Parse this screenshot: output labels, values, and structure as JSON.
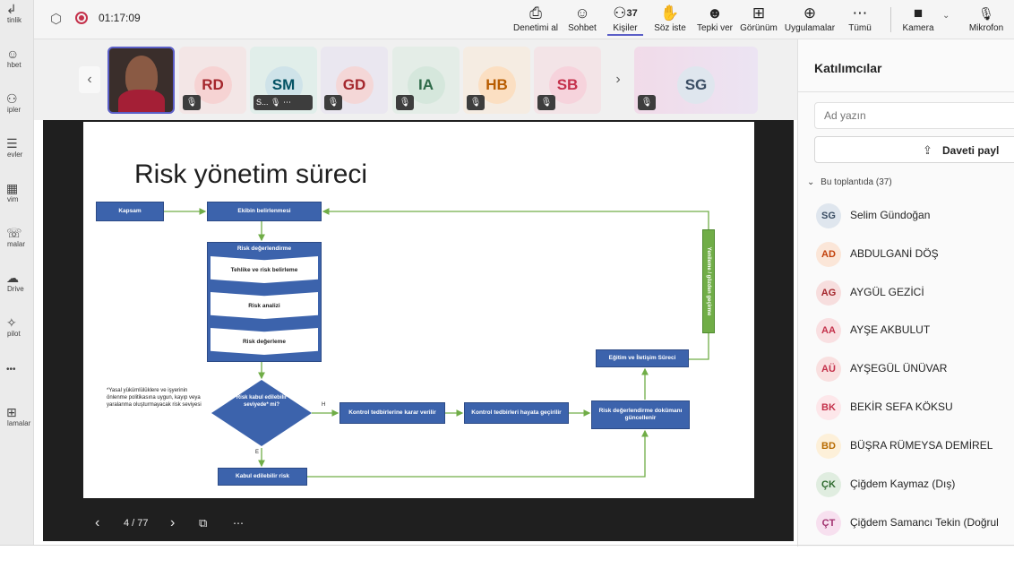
{
  "rail": {
    "items": [
      {
        "icon": "↲",
        "label": "tinlik"
      },
      {
        "icon": "☺",
        "label": "hbet"
      },
      {
        "icon": "⚇",
        "label": "ipler"
      },
      {
        "icon": "☰",
        "label": "evler"
      },
      {
        "icon": "▦",
        "label": "vim"
      },
      {
        "icon": "☏",
        "label": "malar"
      },
      {
        "icon": "☁",
        "label": "Drive"
      },
      {
        "icon": "✧",
        "label": "pilot"
      },
      {
        "icon": "•••",
        "label": ""
      },
      {
        "icon": "⊞",
        "label": "lamalar"
      }
    ]
  },
  "topbar": {
    "timer": "01:17:09",
    "participant_count": "37",
    "buttons": [
      {
        "icon": "⎙",
        "label": "Denetimi al"
      },
      {
        "icon": "☺",
        "label": "Sohbet"
      },
      {
        "icon": "⚇",
        "label": "Kişiler"
      },
      {
        "icon": "✋",
        "label": "Söz iste"
      },
      {
        "icon": "☻",
        "label": "Tepki ver"
      },
      {
        "icon": "⊞",
        "label": "Görünüm"
      },
      {
        "icon": "⊕",
        "label": "Uygulamalar"
      },
      {
        "icon": "⋯",
        "label": "Tümü"
      },
      {
        "icon": "■",
        "label": "Kamera"
      },
      {
        "icon": "🎙",
        "label": "Mikrofon"
      }
    ]
  },
  "strip": {
    "tiles": [
      {
        "initials": "RD",
        "name": ""
      },
      {
        "initials": "SM",
        "name": "S..."
      },
      {
        "initials": "GD",
        "name": ""
      },
      {
        "initials": "IA",
        "name": ""
      },
      {
        "initials": "HB",
        "name": ""
      },
      {
        "initials": "SB",
        "name": ""
      }
    ],
    "pinned": {
      "initials": "SG"
    }
  },
  "slide": {
    "title": "Risk yönetim süreci",
    "boxes": {
      "kapsam": "Kapsam",
      "ekip": "Ekibin belirlenmesi",
      "risk_deg_header": "Risk değerlendirme",
      "tehlike": "Tehlike ve risk belirleme",
      "analiz": "Risk analizi",
      "degerleme": "Risk değerleme",
      "kabul_q": "Risk kabul edilebilir seviyede* mi?",
      "kontrol_karar": "Kontrol tedbirlerine karar verilir",
      "kontrol_hayata": "Kontrol tedbirleri hayata geçirilir",
      "dokuman": "Risk değerlendirme dokümanı güncellenir",
      "egitim": "Eğitim ve İletişim Süreci",
      "kabul_risk": "Kabul edilebilir risk",
      "yenileme": "Yenileme / gözden geçirme"
    },
    "labels": {
      "h": "H",
      "e": "E"
    },
    "footnote": "*Yasal yükümlülüklere ve işyerinin önlenme politikasına uygun, kayıp veya yaralanma oluşturmayacak risk seviyesi"
  },
  "slide_controls": {
    "page": "4 / 77"
  },
  "panel": {
    "title": "Katılımcılar",
    "search_placeholder": "Ad yazın",
    "share_label": "Daveti payl",
    "section_label": "Bu toplantıda (37)",
    "people": [
      {
        "initials": "SG",
        "name": "Selim Gündoğan",
        "bg": "#dfe6ee",
        "fg": "#3b4e64"
      },
      {
        "initials": "AD",
        "name": "ABDULGANİ DÖŞ",
        "bg": "#fbe6d8",
        "fg": "#c2410c"
      },
      {
        "initials": "AG",
        "name": "AYGÜL GEZİCİ",
        "bg": "#f7dede",
        "fg": "#a4262c"
      },
      {
        "initials": "AA",
        "name": "AYŞE AKBULUT",
        "bg": "#f9e0e2",
        "fg": "#c4314b"
      },
      {
        "initials": "AÜ",
        "name": "AYŞEGÜL ÜNÜVAR",
        "bg": "#f9e0e0",
        "fg": "#c4314b"
      },
      {
        "initials": "BK",
        "name": "BEKİR SEFA KÖKSU",
        "bg": "#fde7ea",
        "fg": "#c4314b"
      },
      {
        "initials": "BD",
        "name": "BÜŞRA RÜMEYSA DEMİREL",
        "bg": "#fdf0d9",
        "fg": "#b86b00"
      },
      {
        "initials": "ÇK",
        "name": "Çiğdem Kaymaz (Dış)",
        "bg": "#e0ede0",
        "fg": "#2f6b2f"
      },
      {
        "initials": "ÇT",
        "name": "Çiğdem Samancı Tekin (Doğrul",
        "bg": "#f7e0ef",
        "fg": "#a0306d"
      }
    ]
  },
  "colors": {
    "accent": "#5b5fc7",
    "flow_blue": "#3c63ac",
    "flow_green": "#70ad47",
    "recording": "#c4314b"
  }
}
